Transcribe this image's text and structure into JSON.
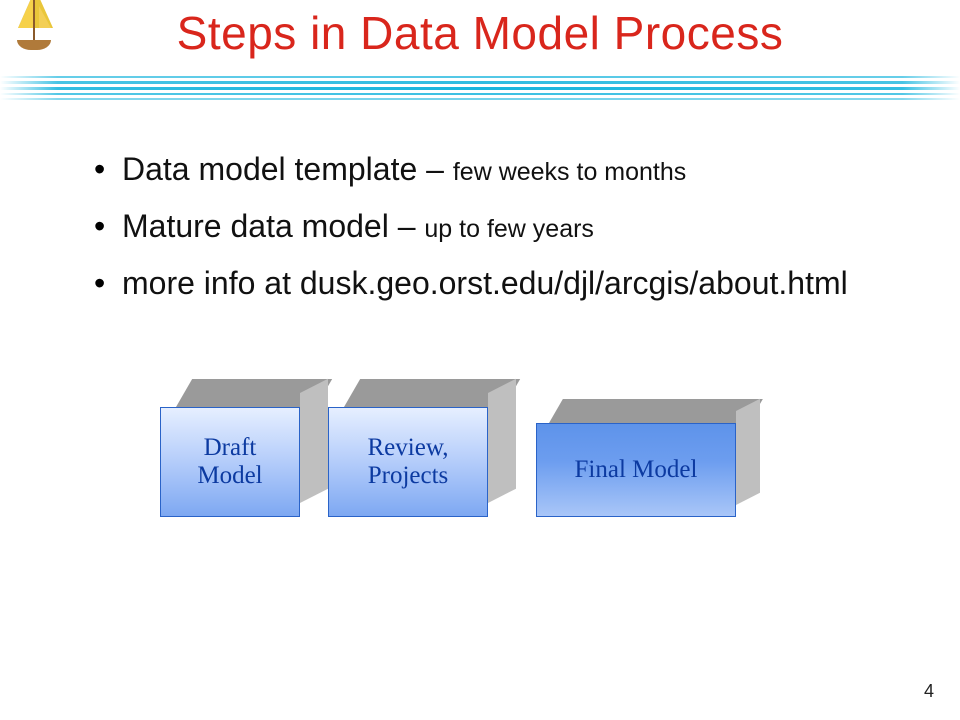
{
  "title": "Steps in Data Model Process",
  "bullets": [
    {
      "strong": "Data model template – ",
      "rest": "few weeks to months"
    },
    {
      "strong": "Mature data model – ",
      "rest": "up to few years"
    },
    {
      "strong": "more info at dusk.geo.orst.edu/djl/arcgis/about.html",
      "rest": ""
    }
  ],
  "boxes": {
    "b1": "Draft\nModel",
    "b2": "Review,\nProjects",
    "b3": "Final Model"
  },
  "page_number": "4"
}
